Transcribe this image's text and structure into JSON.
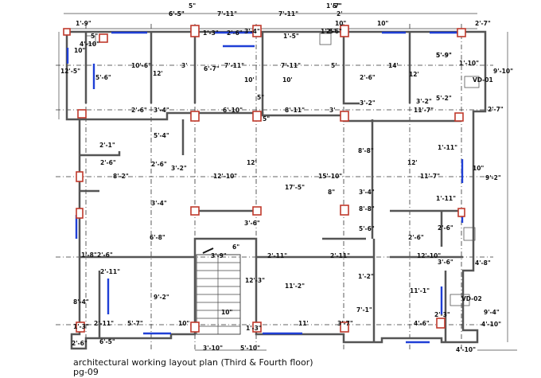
{
  "caption": {
    "title": "architectural working layout plan (Third & Fourth floor)",
    "page": "pg-09"
  },
  "dimensions": [
    "6'-5\"",
    "5\"",
    "7'-11\"",
    "7'-11\"",
    "5\"",
    "2'",
    "1'-7\"",
    "1'-9\"",
    "10\"",
    "2'-7\"",
    "12'-5\"",
    "4'-10\"",
    "10\"",
    "5\"",
    "1'-3\"",
    "2'-6\"",
    "3'-4\"",
    "1'-5\"",
    "2'-6\"",
    "10\"",
    "10'-6\"",
    "12'",
    "3'",
    "7'-11\"",
    "7'-11\"",
    "5'",
    "14'",
    "12'",
    "5'-9\"",
    "1'-10\"",
    "VD-01",
    "9'-10\"",
    "5'-6\"",
    "10'",
    "10'",
    "2'-6\"",
    "6'-7\"",
    "5\"",
    "3'-2\"",
    "5'-2\"",
    "2'-7\"",
    "2'-6\"",
    "3'-4\"",
    "6'-10\"",
    "8'-11\"",
    "3'",
    "11'-7\"",
    "3'-2\"",
    "5'-4\"",
    "5\"",
    "8'-8\"",
    "1'-11\"",
    "2'-1\"",
    "2'-6\"",
    "2'-6\"",
    "3'-2\"",
    "12'",
    "12'",
    "10\"",
    "9'-2\"",
    "8'-2\"",
    "12'-10\"",
    "17'-5\"",
    "15'-10\"",
    "11'-7\"",
    "8\"",
    "3'-4\"",
    "1'-11\"",
    "3'-4\"",
    "3'-6\"",
    "6'-8\"",
    "5'-6\"",
    "2'-6\"",
    "2'-6\"",
    "1'-8\"",
    "2'-6\"",
    "3'-9\"",
    "6\"",
    "2'-11\"",
    "2'-11\"",
    "12'-10\"",
    "3'-6\"",
    "4'-8\"",
    "2'-11\"",
    "12'-3\"",
    "11'-2\"",
    "1'-2\"",
    "11'-1\"",
    "VD-02",
    "9'-2\"",
    "8'-4\"",
    "7'-1\"",
    "9'-4\"",
    "2'-11\"",
    "5'-7\"",
    "10\"",
    "10\"",
    "1'-3\"",
    "11'",
    "3'-7\"",
    "4'-6\"",
    "2'-3\"",
    "1'-3\"",
    "2'-6\"",
    "6'-5\"",
    "3'-10\"",
    "5'-10\"",
    "4'-10\"",
    "4'-10\"",
    "8'-8\"",
    "1'-5\"",
    "6'-5\"",
    "5'-9\""
  ]
}
